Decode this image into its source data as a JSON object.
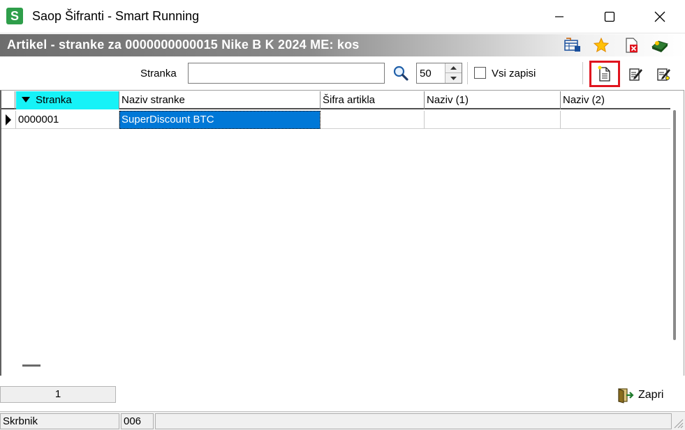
{
  "window": {
    "title": "Saop Šifranti - Smart Running",
    "icon_letter": "S",
    "icon_color": "#2e9e4a"
  },
  "header": {
    "title": "Artikel - stranke za 0000000000015 Nike B K 2024  ME: kos"
  },
  "toolbar": {
    "stranka_label": "Stranka",
    "search_value": "",
    "limit_value": "50",
    "vsi_zapisi_label": "Vsi zapisi",
    "vsi_zapisi_checked": false,
    "highlight_color": "#e0141e"
  },
  "grid": {
    "columns": [
      {
        "label": "Stranka",
        "sorted": true
      },
      {
        "label": "Naziv stranke"
      },
      {
        "label": "Šifra artikla"
      },
      {
        "label": "Naziv (1)"
      },
      {
        "label": "Naziv (2)"
      }
    ],
    "rows": [
      {
        "stranka": "0000001",
        "naziv_stranke": "SuperDiscount BTC",
        "sifra_artikla": "",
        "naziv1": "",
        "naziv2": ""
      }
    ],
    "sorted_header_color": "#16f2f7",
    "selection_color": "#0078d7"
  },
  "footer": {
    "record_count": "1",
    "close_label": "Zapri"
  },
  "statusbar": {
    "user": "Skrbnik",
    "code": "006",
    "message": ""
  }
}
